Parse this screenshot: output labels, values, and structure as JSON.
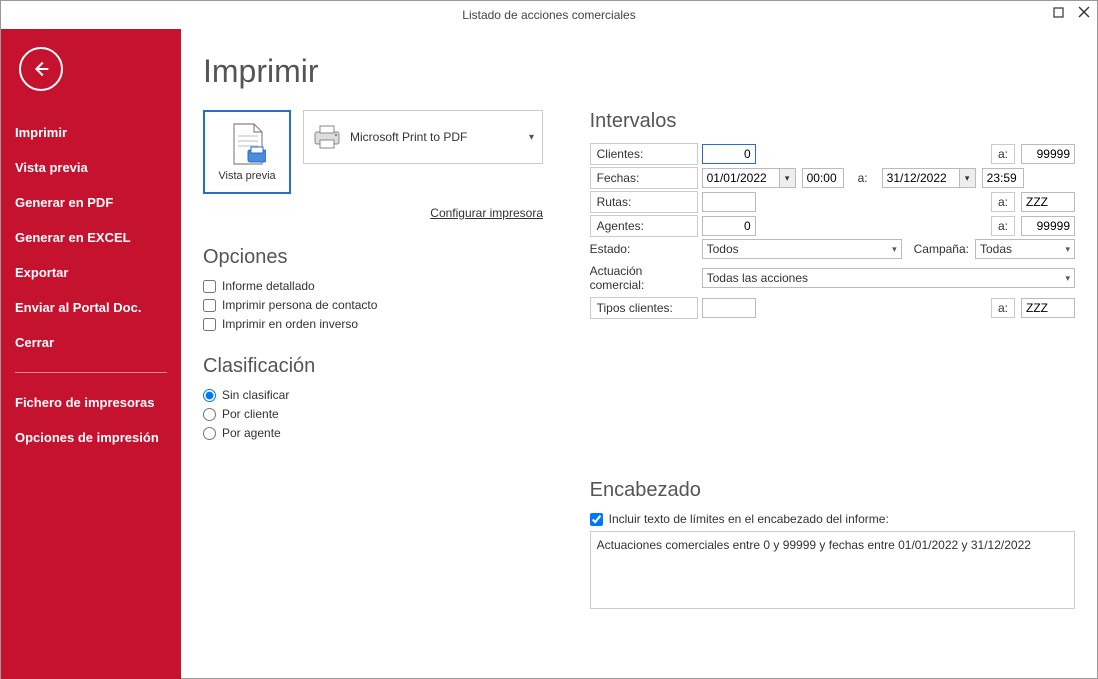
{
  "window": {
    "title": "Listado de acciones comerciales"
  },
  "sidebar": {
    "items": [
      "Imprimir",
      "Vista previa",
      "Generar en PDF",
      "Generar en EXCEL",
      "Exportar",
      "Enviar al Portal Doc.",
      "Cerrar"
    ],
    "items2": [
      "Fichero de impresoras",
      "Opciones de impresión"
    ]
  },
  "page": {
    "title": "Imprimir"
  },
  "preview": {
    "label": "Vista previa"
  },
  "printer": {
    "name": "Microsoft Print to PDF",
    "config_link": "Configurar impresora"
  },
  "options": {
    "heading": "Opciones",
    "detailed": "Informe detallado",
    "contact": "Imprimir persona de contacto",
    "reverse": "Imprimir en orden inverso"
  },
  "classification": {
    "heading": "Clasificación",
    "none": "Sin clasificar",
    "by_client": "Por cliente",
    "by_agent": "Por agente"
  },
  "intervals": {
    "heading": "Intervalos",
    "clients_label": "Clientes:",
    "clients_from": "0",
    "clients_to": "99999",
    "dates_label": "Fechas:",
    "date_from": "01/01/2022",
    "time_from": "00:00",
    "date_to": "31/12/2022",
    "time_to": "23:59",
    "routes_label": "Rutas:",
    "routes_from": "",
    "routes_to": "ZZZ",
    "agents_label": "Agentes:",
    "agents_from": "0",
    "agents_to": "99999",
    "state_label": "Estado:",
    "state_value": "Todos",
    "campaign_label": "Campaña:",
    "campaign_value": "Todas",
    "action_label": "Actuación comercial:",
    "action_value": "Todas las acciones",
    "client_types_label": "Tipos clientes:",
    "client_types_from": "",
    "client_types_to": "ZZZ",
    "a": "a:"
  },
  "header": {
    "heading": "Encabezado",
    "checkbox": "Incluir texto de límites en el encabezado del informe:",
    "text": "Actuaciones comerciales entre 0 y 99999 y fechas entre 01/01/2022 y 31/12/2022"
  }
}
